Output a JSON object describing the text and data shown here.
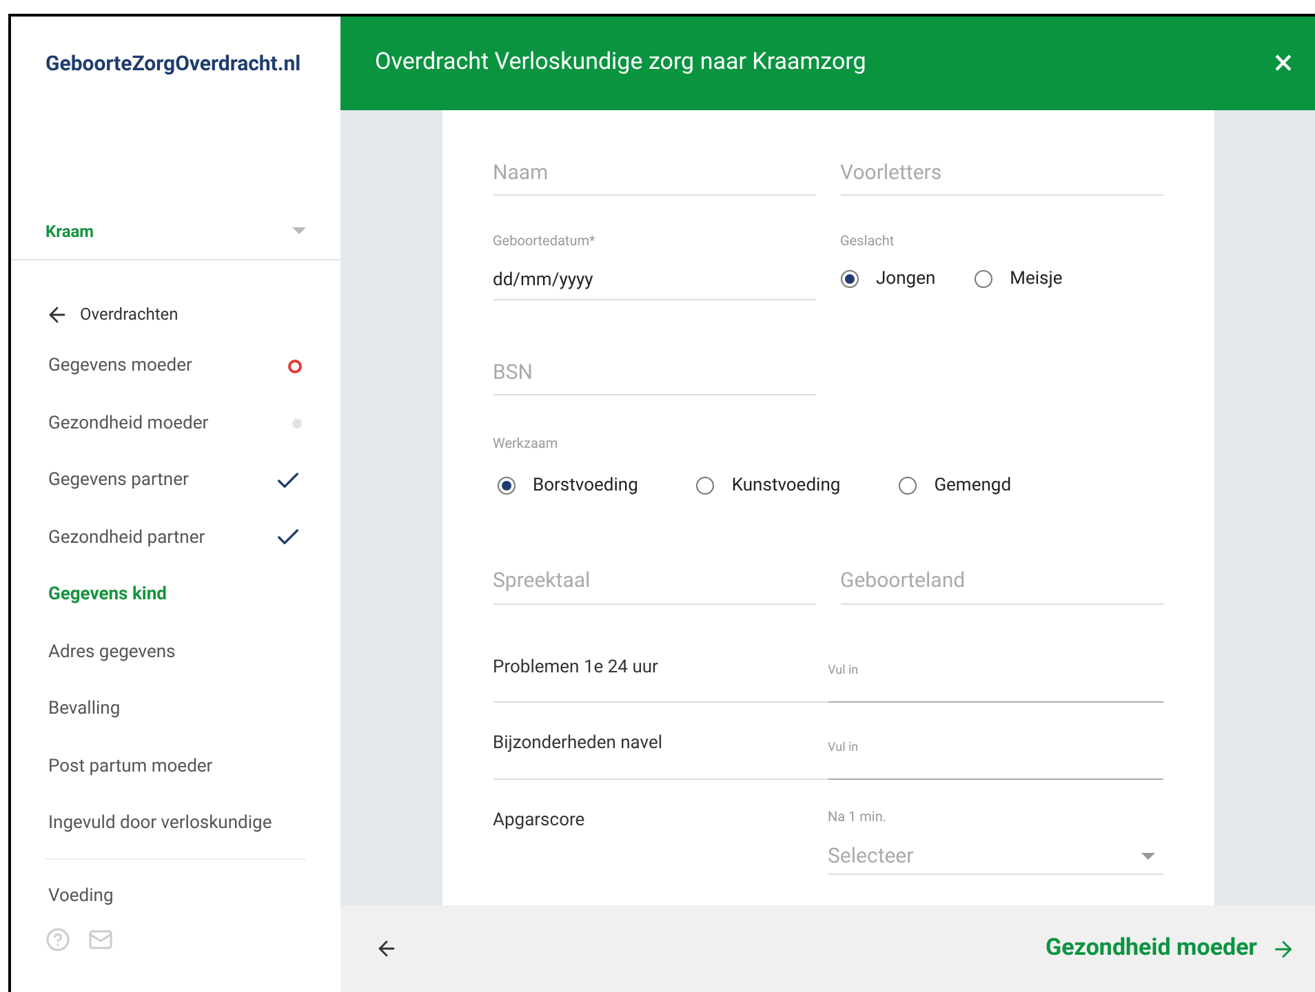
{
  "sidebar": {
    "logo": "GeboorteZorgOverdracht.nl",
    "role_select": {
      "value": "Kraam"
    },
    "back_link": "Overdrachten",
    "items": [
      {
        "label": "Gegevens moeder",
        "kind": "error",
        "selected": false
      },
      {
        "label": "Gezondheid moeder",
        "kind": "pending",
        "selected": false
      },
      {
        "label": "Gegevens partner",
        "kind": "done",
        "selected": false
      },
      {
        "label": "Gezondheid partner",
        "kind": "done",
        "selected": false
      },
      {
        "label": "Gegevens kind",
        "kind": "plain",
        "selected": true
      },
      {
        "label": "Adres gegevens",
        "kind": "plain",
        "selected": false
      },
      {
        "label": "Bevalling",
        "kind": "plain",
        "selected": false
      },
      {
        "label": "Post partum moeder",
        "kind": "plain",
        "selected": false
      },
      {
        "label": "Ingevuld door verloskundige",
        "kind": "plain",
        "selected": false
      }
    ],
    "items_2": [
      {
        "label": "Voeding",
        "selected": false
      }
    ]
  },
  "header": {
    "title": "Overdracht Verloskundige zorg naar Kraamzorg",
    "close": "×"
  },
  "form": {
    "rows": [
      {
        "kind": "pair",
        "fields": [
          {
            "placeholder": "Naam"
          },
          {
            "placeholder": "Voorletters"
          }
        ]
      },
      {
        "kind": "date_gender",
        "date": {
          "label": "Geboortedatum*",
          "value": "dd/mm/yyyy"
        },
        "radio": {
          "label": "Geslacht",
          "options": [
            {
              "label": "Jongen",
              "selected": true
            },
            {
              "label": "Meisje",
              "selected": false
            }
          ]
        }
      },
      {
        "kind": "single",
        "fields": [
          {
            "placeholder": "BSN"
          }
        ]
      },
      {
        "kind": "radio",
        "radio": {
          "label": "Werkzaam",
          "options": [
            {
              "label": "Borstvoeding",
              "selected": true
            },
            {
              "label": "Kunstvoeding",
              "selected": false
            },
            {
              "label": "Gemengd",
              "selected": false
            }
          ]
        }
      },
      {
        "kind": "pair",
        "fields": [
          {
            "placeholder": "Spreektaal"
          },
          {
            "placeholder": "Geboorteland"
          }
        ]
      },
      {
        "kind": "labeled_input",
        "label": "Problemen 1e 24 uur",
        "placeholder": "Vul in"
      },
      {
        "kind": "labeled_input",
        "label": "Bijzonderheden navel",
        "placeholder": "Vul in"
      },
      {
        "kind": "labeled_select",
        "label": "Apgarscore",
        "sublabel": "Na 1 min.",
        "placeholder": "Selecteer"
      }
    ]
  },
  "footer": {
    "next": "Gezondheid moeder"
  }
}
